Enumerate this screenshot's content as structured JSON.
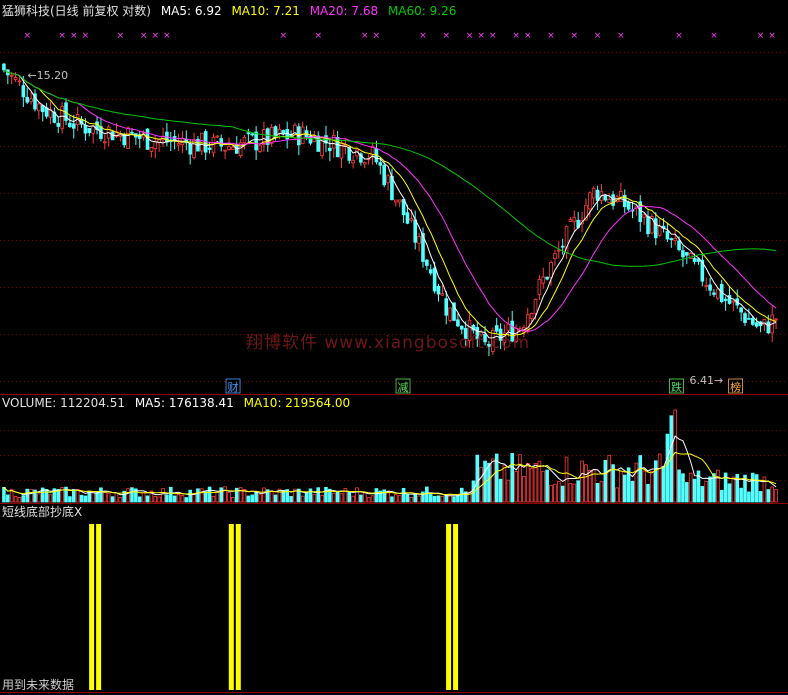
{
  "header": {
    "title": "猛狮科技(日线 前复权 对数)",
    "ma5": "MA5: 6.92",
    "ma10": "MA10: 7.21",
    "ma20": "MA20: 7.68",
    "ma60": "MA60: 9.26"
  },
  "volume_header": {
    "label": "VOLUME: 112204.51",
    "ma5": "MA5: 176138.41",
    "ma10": "MA10: 219564.00"
  },
  "indicator_header": {
    "label": "短线底部抄底X"
  },
  "indicator_footer": "用到未来数据",
  "watermark": "翔博软件 www.xiangbosoft.com",
  "colors": {
    "up": "#ff3b3b",
    "down": "#54ffff",
    "ma5": "#ffffff",
    "ma10": "#ffff00",
    "ma20": "#ff30ff",
    "ma60": "#00c800",
    "signal": "#ffff00",
    "grid": "#7a0000",
    "text": "#c0c0c0"
  },
  "chart_data": [
    {
      "type": "candlestick",
      "title": "猛狮科技(日线 前复权 对数)",
      "scale": "log",
      "annotations": {
        "high_label": "15.20",
        "low_label": "6.41",
        "event_markers": [
          {
            "index": 62,
            "text": "财",
            "color": "#4aa0ff"
          },
          {
            "index": 108,
            "text": "减",
            "color": "#5ae05a"
          },
          {
            "index": 182,
            "text": "跌",
            "color": "#5ae05a"
          },
          {
            "index": 198,
            "text": "榜",
            "color": "#ffaa44"
          }
        ]
      },
      "ohlc": [],
      "ohlc_note": "generated",
      "series": [
        {
          "name": "MA5",
          "last": 6.92
        },
        {
          "name": "MA10",
          "last": 7.21
        },
        {
          "name": "MA20",
          "last": 7.68
        },
        {
          "name": "MA60",
          "last": 9.26
        }
      ],
      "grid": true
    },
    {
      "type": "bar",
      "title": "VOLUME: 112204.51",
      "series": [
        {
          "name": "VOLUME",
          "last": 112204.51
        },
        {
          "name": "MA5",
          "last": 176138.41
        },
        {
          "name": "MA10",
          "last": 219564.0
        }
      ]
    },
    {
      "type": "bar",
      "title": "短线底部抄底X",
      "signal_positions": [
        0.12,
        0.3,
        0.58
      ]
    }
  ]
}
